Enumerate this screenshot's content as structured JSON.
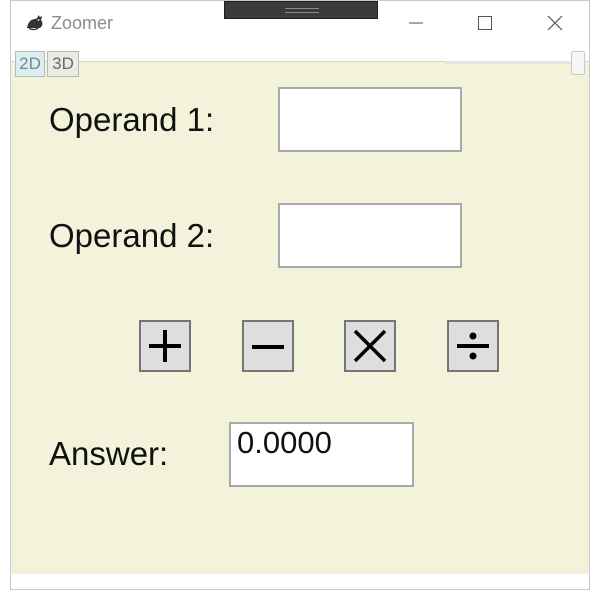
{
  "window": {
    "title": "Zoomer",
    "app_icon": "fox-icon",
    "controls": [
      "minimize-icon",
      "maximize-icon",
      "close-icon"
    ]
  },
  "toolbar": {
    "tab_2d": "2D",
    "tab_3d": "3D"
  },
  "form": {
    "operand1_label": "Operand 1:",
    "operand1_value": "",
    "operand2_label": "Operand 2:",
    "operand2_value": "",
    "operations": [
      "plus-icon",
      "minus-icon",
      "multiply-icon",
      "divide-icon"
    ],
    "answer_label": "Answer:",
    "answer_value": "0.0000"
  },
  "colors": {
    "client_background": "#f3f3dc",
    "tab_2d_active": "#dceef0"
  }
}
